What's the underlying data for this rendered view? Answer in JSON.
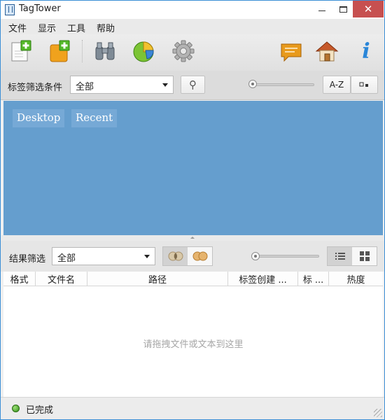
{
  "window": {
    "title": "TagTower",
    "close_glyph": "✕"
  },
  "menu": {
    "items": [
      "文件",
      "显示",
      "工具",
      "帮助"
    ]
  },
  "toolbar": {
    "icons": [
      "new-file-icon",
      "add-tag-icon",
      "binoculars-icon",
      "pie-chart-icon",
      "gear-icon",
      "comment-icon",
      "home-icon",
      "info-icon"
    ],
    "info_glyph": "i"
  },
  "tag_filter": {
    "label": "标签筛选条件",
    "selected": "全部",
    "search_glyph": "⚲",
    "sort_label": "A-Z"
  },
  "tags": [
    "Desktop",
    "Recent"
  ],
  "result_filter": {
    "label": "结果筛选",
    "selected": "全部"
  },
  "table": {
    "columns": [
      "格式",
      "文件名",
      "路径",
      "标签创建 ...",
      "标 ...",
      "热度"
    ],
    "empty_hint": "请拖拽文件或文本到这里"
  },
  "status": {
    "text": "已完成"
  },
  "colors": {
    "tag_area": "#659ece",
    "tag_chip": "#76a9d6",
    "close_button": "#c75050",
    "status_ok": "#2f8f12"
  }
}
